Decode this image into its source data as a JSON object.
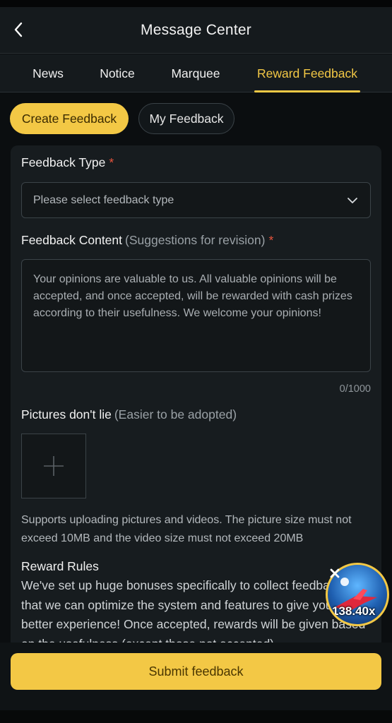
{
  "header": {
    "title": "Message Center"
  },
  "tabs": [
    {
      "label": "News",
      "active": false
    },
    {
      "label": "Notice",
      "active": false
    },
    {
      "label": "Marquee",
      "active": false
    },
    {
      "label": "Reward Feedback",
      "active": true
    }
  ],
  "subtabs": {
    "create": "Create Feedback",
    "mine": "My Feedback"
  },
  "form": {
    "type_label": "Feedback Type",
    "required_mark": "*",
    "type_placeholder": "Please select feedback type",
    "content_label": "Feedback Content",
    "content_hint": "(Suggestions for revision)",
    "content_placeholder": "Your opinions are valuable to us. All valuable opinions will be accepted, and once accepted, will be rewarded with cash prizes according to their usefulness. We welcome your opinions!",
    "counter": "0/1000",
    "pictures_label": "Pictures don't lie",
    "pictures_hint": "(Easier to be adopted)",
    "support_text": "Supports uploading pictures and videos. The picture size must not exceed 10MB and the video size must not exceed 20MB",
    "rules_title": "Reward Rules",
    "rules_text": "We've set up huge bonuses specifically to collect feedback so that we can optimize the system and features to give you a better experience! Once accepted, rewards will be given based on the usefulness (except those not accepted)"
  },
  "promo": {
    "multiplier": "138.40x"
  },
  "footer": {
    "submit_label": "Submit feedback"
  },
  "colors": {
    "accent": "#f3c845",
    "background": "#0b0e10",
    "card": "#171c1f",
    "required": "#e5533c"
  },
  "icons": {
    "back": "chevron-left-icon",
    "select": "chevron-down-icon",
    "upload": "plus-icon",
    "close": "close-icon"
  }
}
